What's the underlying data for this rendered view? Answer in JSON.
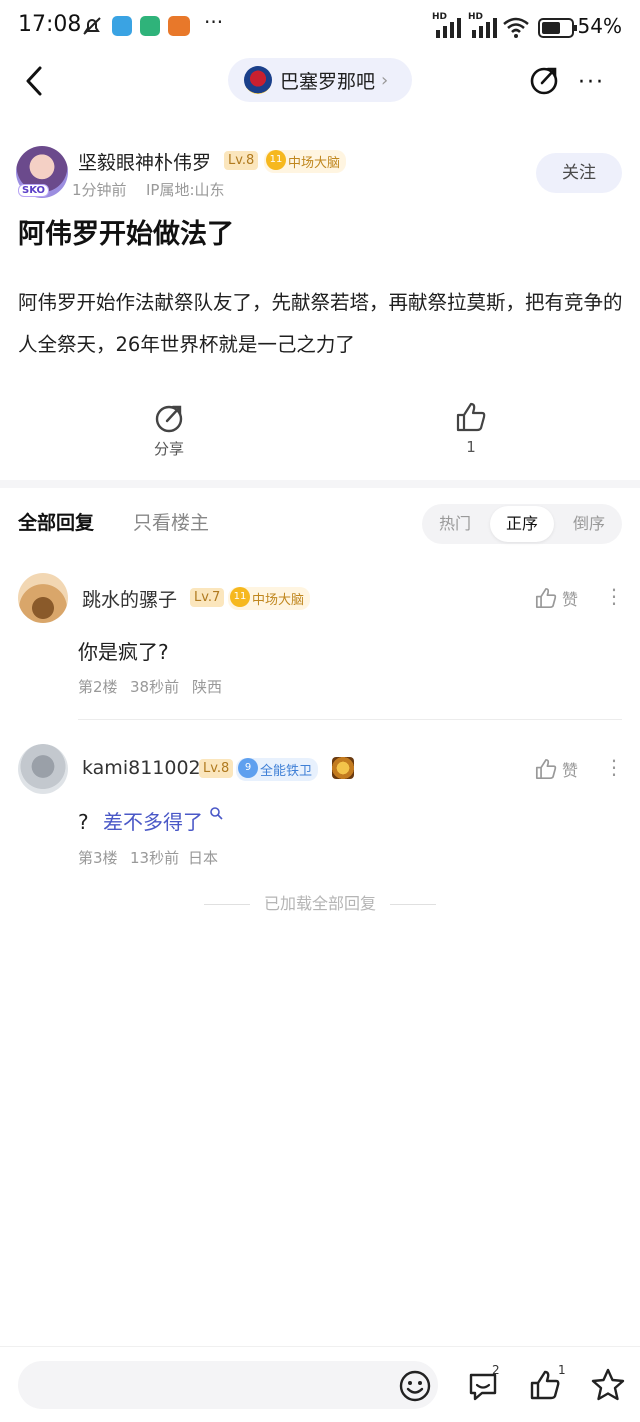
{
  "status_bar": {
    "time": "17:08",
    "battery": "54%",
    "hd1": "HD",
    "hd2": "HD"
  },
  "nav": {
    "forum_name": "巴塞罗那吧",
    "chevron": "›"
  },
  "post": {
    "author": "坚毅眼神朴伟罗",
    "avatar_badge": "SKO",
    "level": "Lv.8",
    "medal_num": "11",
    "title_badge": "中场大脑",
    "time_ago": "1分钟前",
    "ip": "IP属地:山东",
    "follow_label": "关注",
    "title": "阿伟罗开始做法了",
    "body": "阿伟罗开始作法献祭队友了，先献祭若塔，再献祭拉莫斯，把有竞争的人全祭天，26年世界杯就是一己之力了",
    "share_label": "分享",
    "like_count": "1"
  },
  "tabs": {
    "all": "全部回复",
    "owner_only": "只看楼主"
  },
  "sort": {
    "hot": "热门",
    "asc": "正序",
    "desc": "倒序",
    "active": "asc"
  },
  "comments": [
    {
      "name": "跳水的骡子",
      "level": "Lv.7",
      "medal_num": "11",
      "title_badge": "中场大脑",
      "like_label": "赞",
      "text": "你是疯了?",
      "floor": "第2楼",
      "time": "38秒前",
      "location": "陕西"
    },
    {
      "name": "kami811002",
      "level": "Lv.8",
      "medal_num": "9",
      "title_badge": "全能铁卫",
      "like_label": "赞",
      "text_prefix": "?",
      "text_link": "差不多得了",
      "floor": "第3楼",
      "time": "13秒前",
      "location": "日本"
    }
  ],
  "loaded_all": "已加载全部回复",
  "bottom_bar": {
    "reply_placeholder": "",
    "comment_count": "2",
    "like_count": "1"
  },
  "icons": [
    "back-icon",
    "share-icon",
    "more-icon",
    "thumbs-up-icon",
    "emoji-icon",
    "comment-icon",
    "star-icon",
    "search-icon"
  ],
  "colors": {
    "accent": "#4a58c7",
    "pill_bg": "#eef0fb",
    "level_bg": "#fbe6bd",
    "medal": "#f6b81e"
  }
}
